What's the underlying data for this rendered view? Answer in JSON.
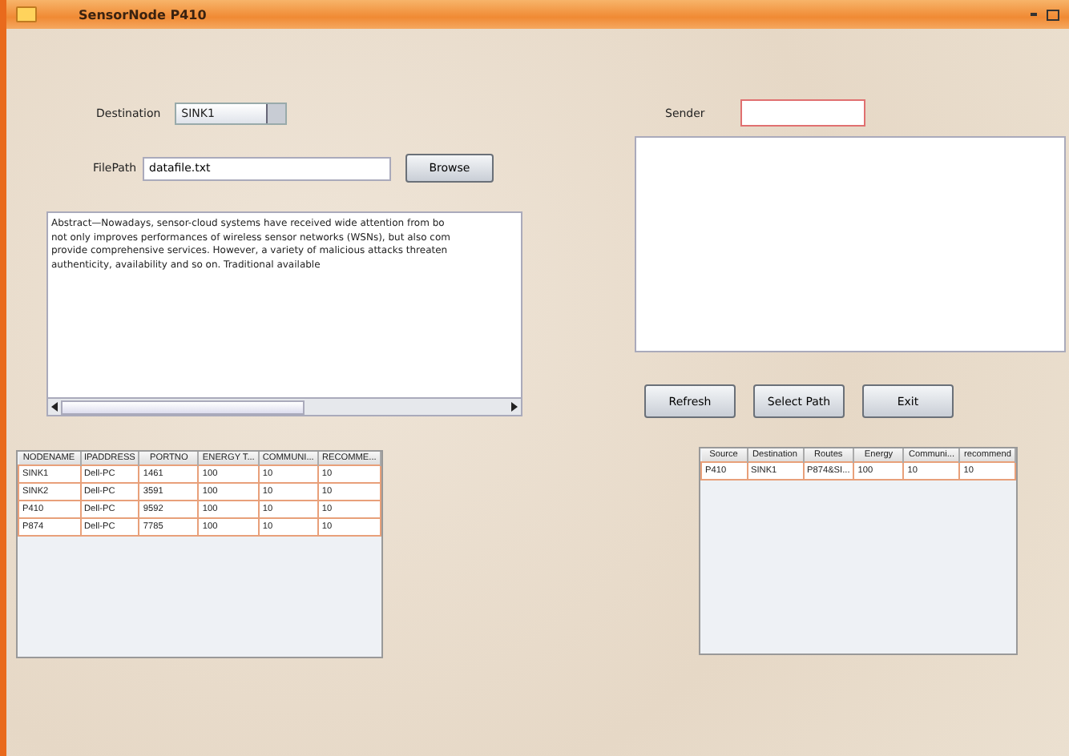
{
  "window": {
    "title": "SensorNode P410"
  },
  "destination": {
    "label": "Destination",
    "value": "SINK1"
  },
  "file_path": {
    "label": "FilePath",
    "value": "datafile.txt"
  },
  "browse_button": "Browse",
  "text_area": {
    "lines": [
      "Abstract—Nowadays, sensor-cloud systems have received wide attention from bo",
      "not only improves performances of wireless sensor networks (WSNs), but also com",
      "provide comprehensive services. However, a variety of malicious attacks threaten",
      "authenticity, availability and so on. Traditional available"
    ]
  },
  "sender": {
    "label": "Sender"
  },
  "buttons": [
    "Refresh",
    "Select Path",
    "Exit"
  ],
  "nodes_table": {
    "columns": [
      "NODENAME",
      "IPADDRESS",
      "PORTNO",
      "ENERGY T...",
      "COMMUNI...",
      "RECOMME..."
    ],
    "rows": [
      [
        "SINK1",
        "Dell-PC",
        "1461",
        "100",
        "10",
        "10"
      ],
      [
        "SINK2",
        "Dell-PC",
        "3591",
        "100",
        "10",
        "10"
      ],
      [
        "P410",
        "Dell-PC",
        "9592",
        "100",
        "10",
        "10"
      ],
      [
        "P874",
        "Dell-PC",
        "7785",
        "100",
        "10",
        "10"
      ]
    ]
  },
  "path_table": {
    "columns": [
      "Source",
      "Destination",
      "Routes",
      "Energy",
      "Communi...",
      "recommend"
    ],
    "rows": [
      [
        "P410",
        "SINK1",
        "P874&SI...",
        "100",
        "10",
        "10"
      ]
    ]
  }
}
